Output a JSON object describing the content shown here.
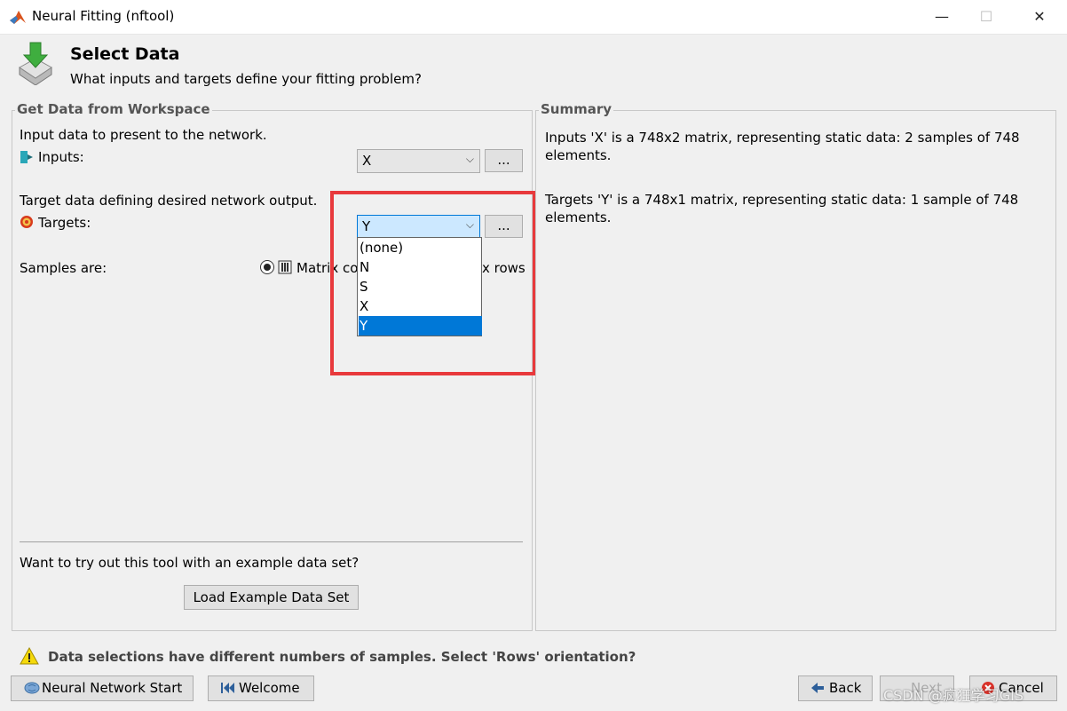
{
  "window": {
    "title": "Neural Fitting (nftool)",
    "minimize": "—",
    "maximize": "☐",
    "close": "✕"
  },
  "header": {
    "title": "Select Data",
    "subtitle": "What inputs and targets define your fitting problem?"
  },
  "left_panel": {
    "title": "Get Data from Workspace",
    "input_desc": "Input data to present to the network.",
    "inputs_label": "Inputs:",
    "inputs_value": "X",
    "browse_label": "...",
    "target_desc": "Target data defining desired network output.",
    "targets_label": "Targets:",
    "targets_value": "Y",
    "targets_options": [
      "(none)",
      "N",
      "S",
      "X",
      "Y"
    ],
    "samples_label": "Samples are:",
    "samples_option_columns": "Matrix co",
    "samples_option_rows": "x rows",
    "example_prompt": "Want to try out this tool with an example data set?",
    "load_button": "Load Example Data Set"
  },
  "summary": {
    "title": "Summary",
    "inputs_text": "Inputs 'X' is a 748x2 matrix, representing static data: 2 samples of 748 elements.",
    "targets_text": "Targets 'Y' is a 748x1 matrix, representing static data: 1 sample of 748 elements."
  },
  "warning": {
    "text": "Data selections have different numbers of samples. Select 'Rows' orientation?"
  },
  "footer": {
    "nn_start": "Neural Network Start",
    "welcome": "Welcome",
    "back": "Back",
    "next": "Next",
    "cancel": "Cancel"
  },
  "watermark": "CSDN @疯狂学习GIS",
  "colors": {
    "highlight": "#0078d7",
    "selected_combo": "#cce8ff",
    "annotation_box": "#e8393c"
  }
}
